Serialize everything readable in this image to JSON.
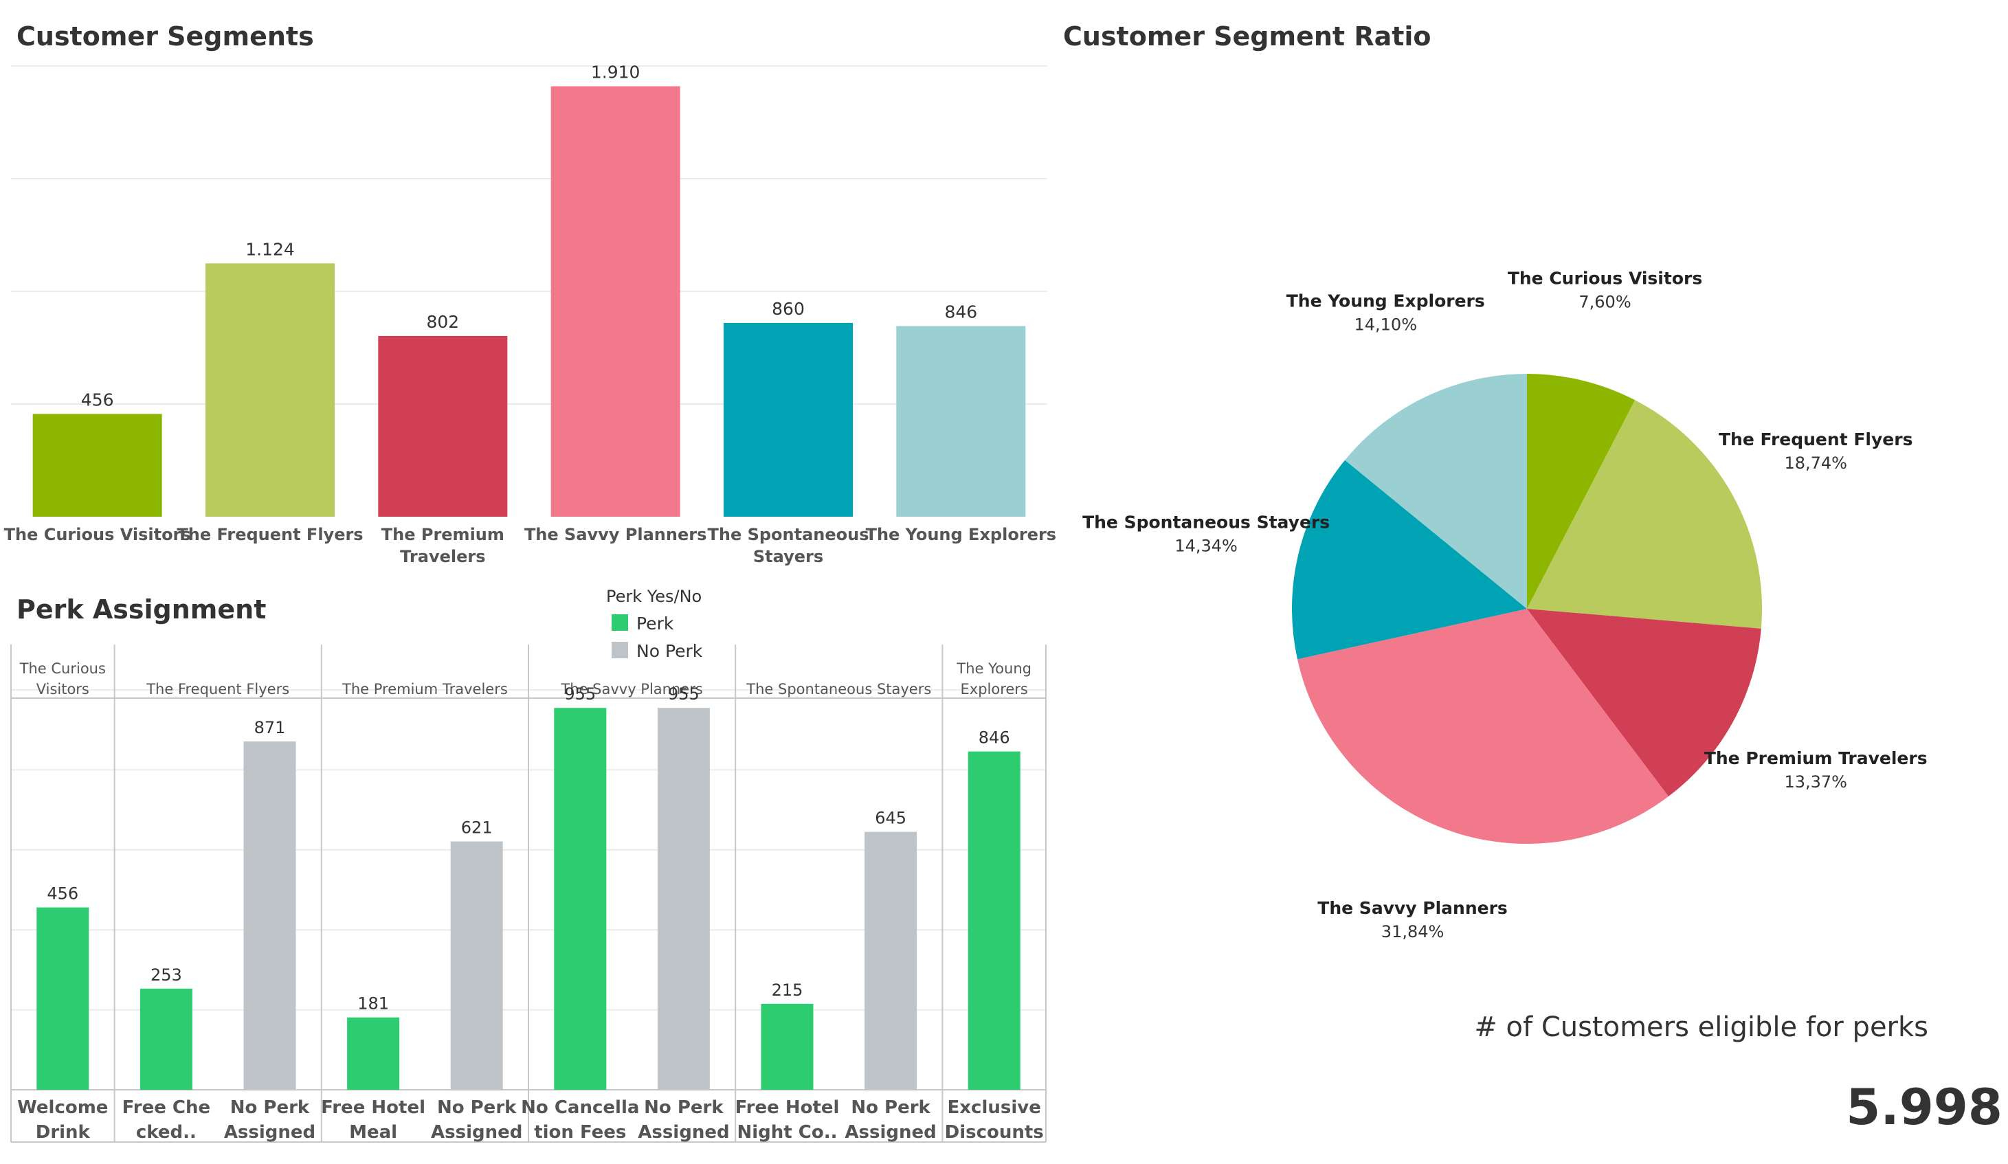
{
  "kpi": {
    "label": "# of Customers eligible for perks",
    "value": "5.998"
  },
  "legend": {
    "title": "Perk Yes/No",
    "items": [
      {
        "label": "Perk",
        "color": "#2ecc71"
      },
      {
        "label": "No Perk",
        "color": "#bfc4c8"
      }
    ]
  },
  "chart_data": [
    {
      "id": "segments",
      "type": "bar",
      "title": "Customer Segments",
      "categories": [
        [
          "The Curious Visitors"
        ],
        [
          "The Frequent Flyers"
        ],
        [
          "The Premium",
          "Travelers"
        ],
        [
          "The Savvy Planners"
        ],
        [
          "The Spontaneous",
          "Stayers"
        ],
        [
          "The Young Explorers"
        ]
      ],
      "values": [
        456,
        1124,
        802,
        1910,
        860,
        846
      ],
      "value_labels": [
        "456",
        "1.124",
        "802",
        "1.910",
        "860",
        "846"
      ],
      "colors": [
        "#8db600",
        "#b8cb5c",
        "#d13f55",
        "#f2788c",
        "#00a3b4",
        "#9bd0d3"
      ],
      "ylim": [
        0,
        2000
      ],
      "grid": true,
      "axis_labels_shown": false
    },
    {
      "id": "perks",
      "type": "bar",
      "title": "Perk Assignment",
      "groups": [
        {
          "header": [
            "The Curious",
            "Visitors"
          ],
          "bars": [
            {
              "label": [
                "Welcome",
                "Drink"
              ],
              "value": 456,
              "perk": true
            }
          ]
        },
        {
          "header": [
            "The Frequent Flyers"
          ],
          "bars": [
            {
              "label": [
                "Free Che",
                "cked.."
              ],
              "value": 253,
              "perk": true
            },
            {
              "label": [
                "No Perk",
                "Assigned"
              ],
              "value": 871,
              "perk": false
            }
          ]
        },
        {
          "header": [
            "The Premium Travelers"
          ],
          "bars": [
            {
              "label": [
                "Free Hotel",
                "Meal"
              ],
              "value": 181,
              "perk": true
            },
            {
              "label": [
                "No Perk",
                "Assigned"
              ],
              "value": 621,
              "perk": false
            }
          ]
        },
        {
          "header": [
            "The Savvy Planners"
          ],
          "bars": [
            {
              "label": [
                "No Cancella",
                "tion Fees"
              ],
              "value": 955,
              "perk": true
            },
            {
              "label": [
                "No Perk",
                "Assigned"
              ],
              "value": 955,
              "perk": false
            }
          ]
        },
        {
          "header": [
            "The Spontaneous Stayers"
          ],
          "bars": [
            {
              "label": [
                "Free Hotel",
                "Night Co.."
              ],
              "value": 215,
              "perk": true
            },
            {
              "label": [
                "No Perk",
                "Assigned"
              ],
              "value": 645,
              "perk": false
            }
          ]
        },
        {
          "header": [
            "The Young",
            "Explorers"
          ],
          "bars": [
            {
              "label": [
                "Exclusive",
                "Discounts"
              ],
              "value": 846,
              "perk": true
            }
          ]
        }
      ],
      "ylim": [
        0,
        1000
      ],
      "grid": true
    },
    {
      "id": "ratio",
      "type": "pie",
      "title": "Customer Segment Ratio",
      "slices": [
        {
          "name": "The Curious Visitors",
          "value": 7.6,
          "label": "7,60%",
          "color": "#8db600"
        },
        {
          "name": "The Frequent Flyers",
          "value": 18.74,
          "label": "18,74%",
          "color": "#b8cb5c"
        },
        {
          "name": "The Premium Travelers",
          "value": 13.37,
          "label": "13,37%",
          "color": "#d13f55"
        },
        {
          "name": "The Savvy Planners",
          "value": 31.84,
          "label": "31,84%",
          "color": "#f2788c"
        },
        {
          "name": "The Spontaneous Stayers",
          "value": 14.34,
          "label": "14,34%",
          "color": "#00a3b4"
        },
        {
          "name": "The Young Explorers",
          "value": 14.1,
          "label": "14,10%",
          "color": "#9bd0d3"
        }
      ],
      "start": "12 o'clock",
      "direction": "clockwise"
    }
  ]
}
